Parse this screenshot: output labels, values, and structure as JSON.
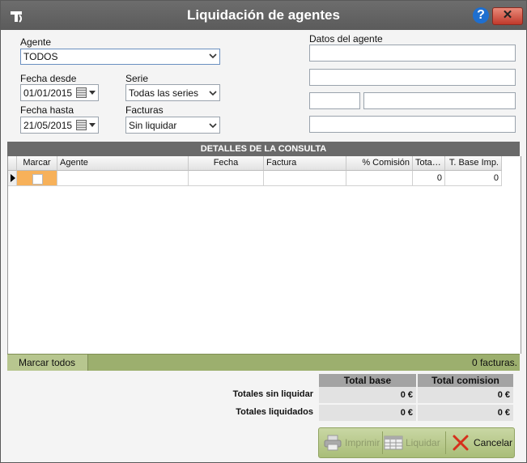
{
  "window": {
    "title": "Liquidación de agentes",
    "help_label": "?",
    "close_label": "✕"
  },
  "form": {
    "agente": {
      "label": "Agente",
      "value": "TODOS"
    },
    "fecha_desde": {
      "label": "Fecha desde",
      "value": "01/01/2015"
    },
    "fecha_hasta": {
      "label": "Fecha hasta",
      "value": "21/05/2015"
    },
    "serie": {
      "label": "Serie",
      "value": "Todas las series"
    },
    "facturas": {
      "label": "Facturas",
      "value": "Sin liquidar"
    },
    "datos_agente": {
      "label": "Datos del agente"
    }
  },
  "grid": {
    "title": "DETALLES DE LA CONSULTA",
    "columns": [
      "Marcar",
      "Agente",
      "Fecha",
      "Factura",
      "% Comisión",
      "Tota…",
      "T. Base Imp."
    ],
    "row": {
      "total": "0",
      "base": "0"
    }
  },
  "status": {
    "mark_all": "Marcar todos",
    "count": "0 facturas."
  },
  "totals": {
    "headers": [
      "Total base",
      "Total comision"
    ],
    "rows": [
      {
        "label": "Totales sin liquidar",
        "base": "0 €",
        "comision": "0 €"
      },
      {
        "label": "Totales liquidados",
        "base": "0 €",
        "comision": "0 €"
      }
    ]
  },
  "buttons": {
    "print": "Imprimir",
    "liquidate": "Liquidar",
    "cancel": "Cancelar"
  },
  "icons": [
    "app-logo-icon",
    "help-icon",
    "close-icon",
    "calendar-icon",
    "printer-icon",
    "table-icon",
    "cancel-x-icon",
    "row-pointer-icon"
  ]
}
